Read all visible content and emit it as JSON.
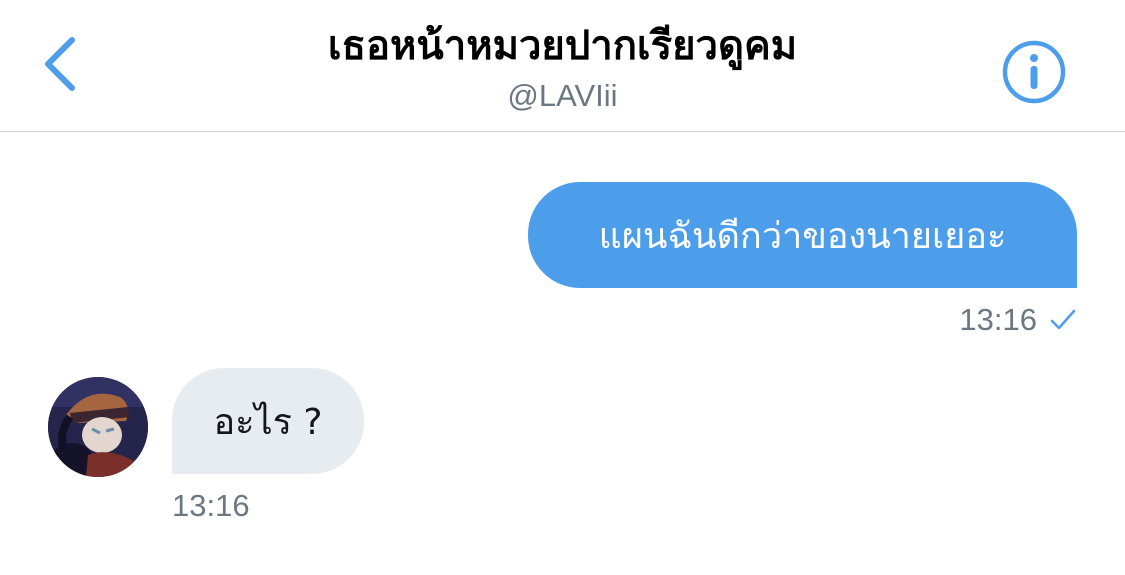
{
  "header": {
    "title": "เธอหน้าหมวยปากเรียวดูคม",
    "handle": "@LAVIii",
    "back_icon": "chevron-left-icon",
    "info_icon": "info-circle-icon",
    "accent_color": "#4c9eeb"
  },
  "messages": [
    {
      "direction": "outgoing",
      "text": "แผนฉันดีกว่าของนายเยอะ",
      "time": "13:16",
      "status_icon": "check-icon"
    },
    {
      "direction": "incoming",
      "text": "อะไร ?",
      "time": "13:16",
      "avatar_icon": "avatar-image"
    }
  ],
  "colors": {
    "outgoing_bubble": "#4c9eeb",
    "incoming_bubble": "#e6ecf0",
    "secondary_text": "#6b7884"
  }
}
